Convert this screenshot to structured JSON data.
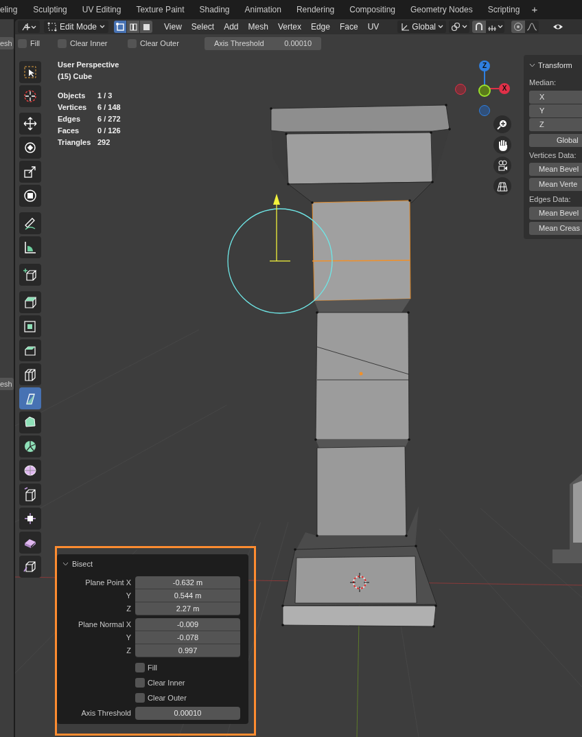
{
  "workspace_tabs": [
    {
      "label": "eling",
      "selected": false
    },
    {
      "label": "Sculpting",
      "selected": false
    },
    {
      "label": "UV Editing",
      "selected": false
    },
    {
      "label": "Texture Paint",
      "selected": false
    },
    {
      "label": "Shading",
      "selected": false
    },
    {
      "label": "Animation",
      "selected": false
    },
    {
      "label": "Rendering",
      "selected": false
    },
    {
      "label": "Compositing",
      "selected": false
    },
    {
      "label": "Geometry Nodes",
      "selected": false
    },
    {
      "label": "Scripting",
      "selected": false
    }
  ],
  "add_tab": "+",
  "left_editor": {
    "labels": [
      "esh",
      "esh"
    ]
  },
  "header": {
    "mode": "Edit Mode",
    "select_modes": [
      {
        "selected": true
      },
      {
        "selected": false
      },
      {
        "selected": false
      }
    ],
    "menus": [
      "View",
      "Select",
      "Add",
      "Mesh",
      "Vertex",
      "Edge",
      "Face",
      "UV"
    ],
    "orientation": "Global"
  },
  "tool_settings": {
    "checkboxes": [
      {
        "label": "Fill",
        "checked": false
      },
      {
        "label": "Clear Inner",
        "checked": false
      },
      {
        "label": "Clear Outer",
        "checked": false
      }
    ],
    "axis_threshold": {
      "label": "Axis Threshold",
      "value": "0.00010"
    }
  },
  "toolbar": {
    "tools": [
      {
        "selected": false
      },
      {
        "selected": false
      },
      {
        "selected": false
      },
      {
        "selected": false
      },
      {
        "selected": false
      },
      {
        "selected": false
      },
      {
        "selected": false
      },
      {
        "selected": false
      },
      {
        "selected": false
      },
      {
        "selected": false
      },
      {
        "selected": false
      },
      {
        "selected": false
      },
      {
        "selected": false
      },
      {
        "selected": true
      },
      {
        "selected": false
      },
      {
        "selected": false
      },
      {
        "selected": false
      },
      {
        "selected": false
      },
      {
        "selected": false
      },
      {
        "selected": false
      },
      {
        "selected": false
      }
    ]
  },
  "viewport_info": {
    "view": "User Perspective",
    "object": "(15) Cube",
    "stats": [
      {
        "label": "Objects",
        "value": "1 / 3"
      },
      {
        "label": "Vertices",
        "value": "6 / 148"
      },
      {
        "label": "Edges",
        "value": "6 / 272"
      },
      {
        "label": "Faces",
        "value": "0 / 126"
      },
      {
        "label": "Triangles",
        "value": "292"
      }
    ]
  },
  "gizmo": {
    "axes": [
      "Z",
      "X"
    ]
  },
  "sidebar": {
    "title": "Transform",
    "median_label": "Median:",
    "fields": [
      "X",
      "Y",
      "Z"
    ],
    "space": "Global",
    "sections": [
      {
        "title": "Vertices Data:",
        "buttons": [
          "Mean Bevel",
          "Mean Verte"
        ]
      },
      {
        "title": "Edges Data:",
        "buttons": [
          "Mean Bevel",
          "Mean Creas"
        ]
      }
    ]
  },
  "operator_panel": {
    "title": "Bisect",
    "rows": [
      {
        "kind": "vector",
        "items": [
          {
            "label": "Plane Point X",
            "value": "-0.632 m"
          },
          {
            "label": "Y",
            "value": "0.544 m"
          },
          {
            "label": "Z",
            "value": "2.27 m"
          }
        ]
      },
      {
        "kind": "vector",
        "items": [
          {
            "label": "Plane Normal X",
            "value": "-0.009"
          },
          {
            "label": "Y",
            "value": "-0.078"
          },
          {
            "label": "Z",
            "value": "0.997"
          }
        ]
      },
      {
        "kind": "checkbox",
        "label": "Fill",
        "checked": false
      },
      {
        "kind": "checkbox",
        "label": "Clear Inner",
        "checked": false
      },
      {
        "kind": "checkbox",
        "label": "Clear Outer",
        "checked": false
      },
      {
        "kind": "value",
        "label": "Axis Threshold",
        "value": "0.00010"
      }
    ]
  }
}
